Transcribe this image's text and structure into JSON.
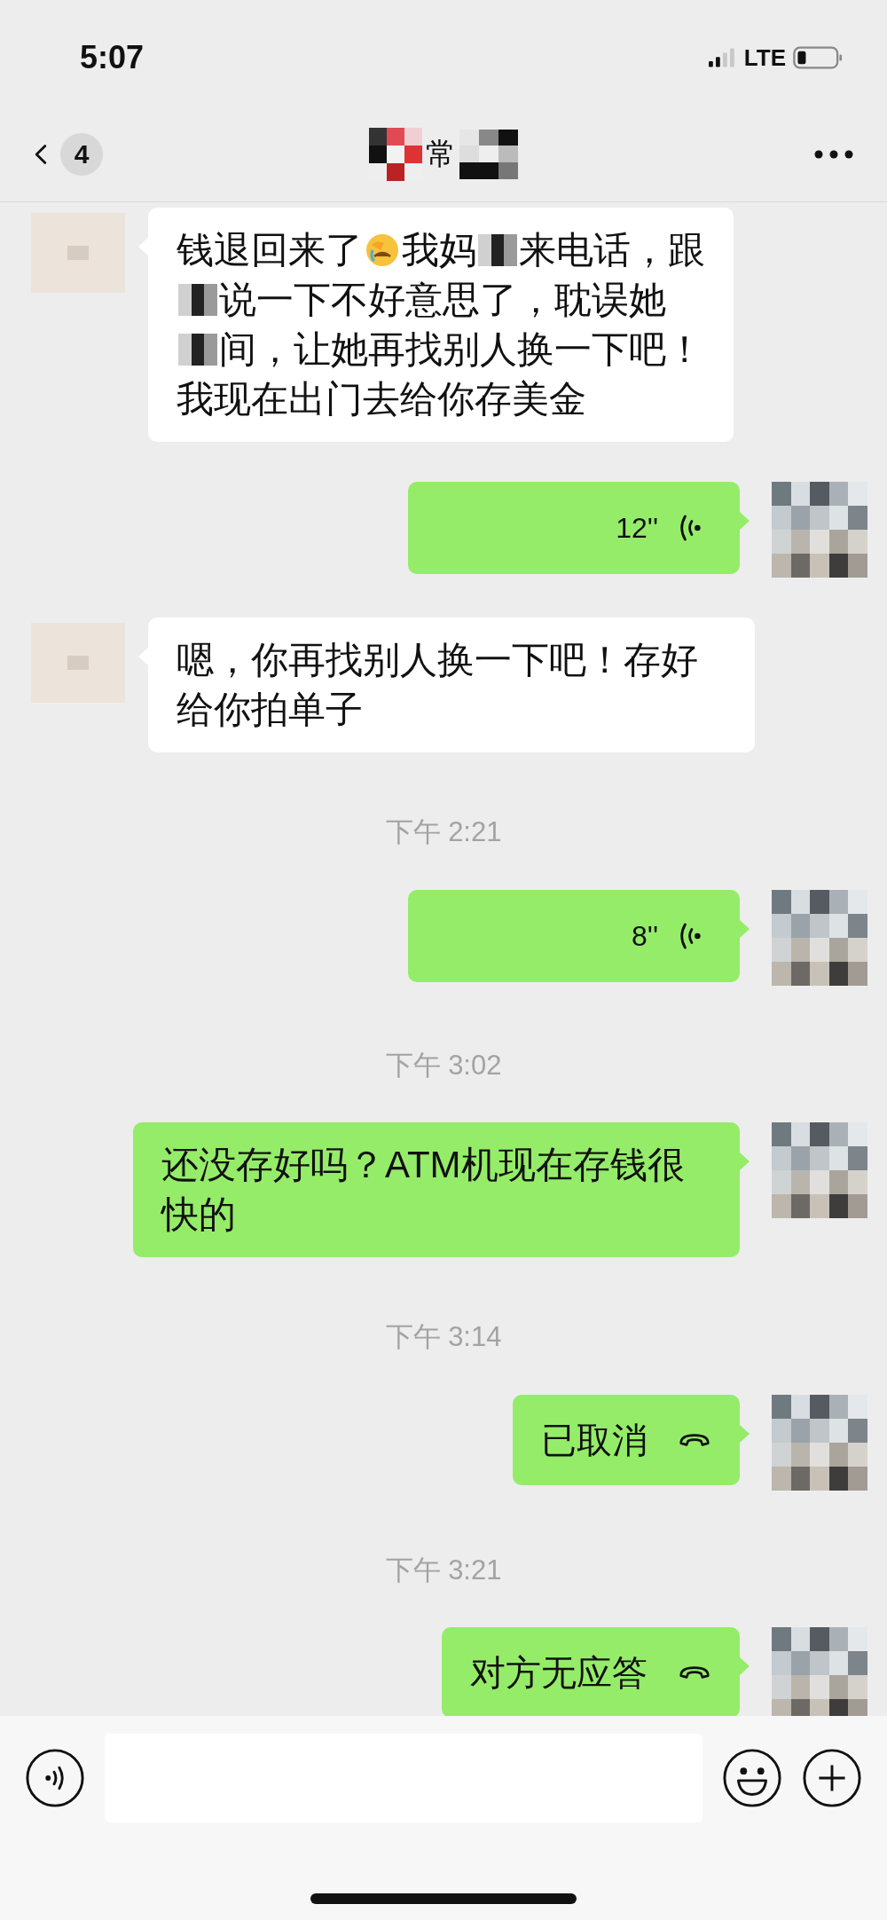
{
  "status_bar": {
    "time": "5:07",
    "network": "LTE"
  },
  "header": {
    "back_badge": "4",
    "title": "常"
  },
  "messages": [
    {
      "kind": "text",
      "outgoing": false,
      "lines": [
        [
          {
            "kind": "text",
            "text": "钱退回来了"
          },
          {
            "kind": "emoji"
          },
          {
            "kind": "text",
            "text": "我妈"
          },
          {
            "kind": "mosaic"
          },
          {
            "kind": "text",
            "text": "来电话，跟"
          }
        ],
        [
          {
            "kind": "mosaic"
          },
          {
            "kind": "text",
            "text": "说一下不好意思了，耽误她"
          }
        ],
        [
          {
            "kind": "mosaic"
          },
          {
            "kind": "text",
            "text": "间，让她再找别人换一下吧！"
          }
        ],
        [
          {
            "kind": "text",
            "text": "我现在出门去给你存美金"
          }
        ]
      ]
    },
    {
      "kind": "voice",
      "outgoing": true,
      "duration": "12''"
    },
    {
      "kind": "text",
      "outgoing": false,
      "text": "嗯，你再找别人换一下吧！存好给你拍单子"
    },
    {
      "kind": "time",
      "text": "下午 2:21"
    },
    {
      "kind": "voice",
      "outgoing": true,
      "duration": "8''"
    },
    {
      "kind": "time",
      "text": "下午 3:02"
    },
    {
      "kind": "text",
      "outgoing": true,
      "text": "还没存好吗？ATM机现在存钱很快的"
    },
    {
      "kind": "time",
      "text": "下午 3:14"
    },
    {
      "kind": "call",
      "outgoing": true,
      "text": "已取消"
    },
    {
      "kind": "time",
      "text": "下午 3:21"
    },
    {
      "kind": "call",
      "outgoing": true,
      "text": "对方无应答"
    }
  ]
}
